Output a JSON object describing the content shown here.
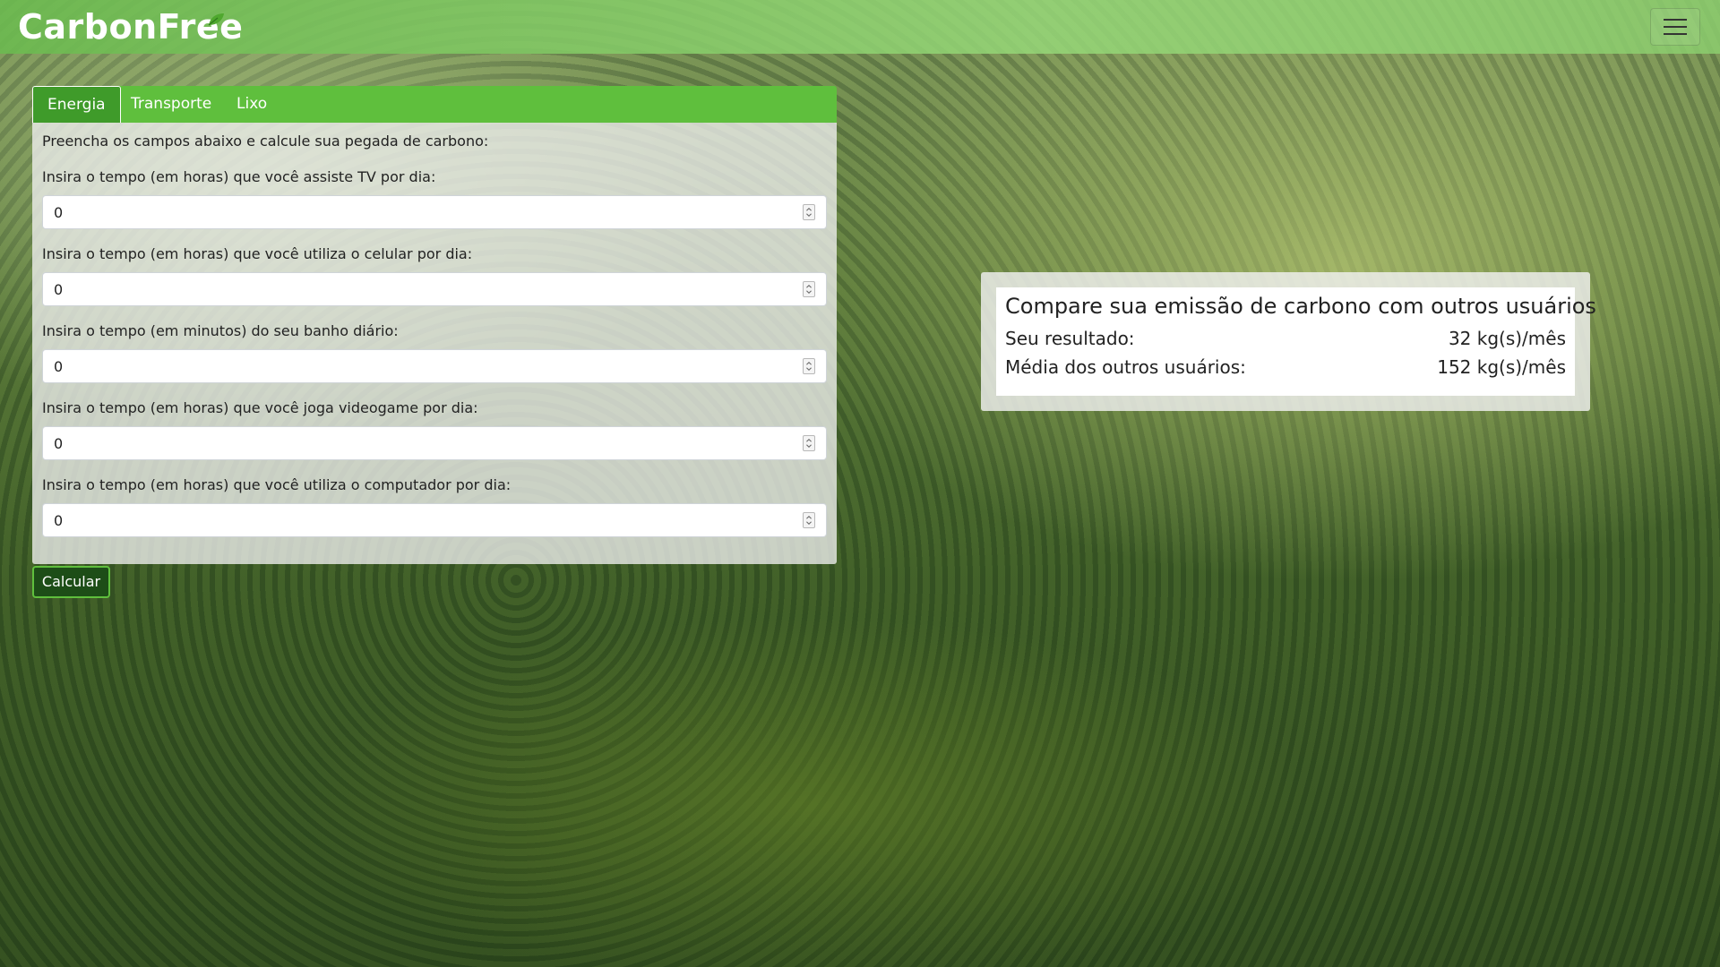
{
  "navbar": {
    "brand": "CarbonFree",
    "menu_icon": "hamburger-icon"
  },
  "tabs": [
    {
      "label": "Energia",
      "active": true
    },
    {
      "label": "Transporte",
      "active": false
    },
    {
      "label": "Lixo",
      "active": false
    }
  ],
  "form": {
    "intro": "Preencha os campos abaixo e calcule sua pegada de carbono:",
    "fields": [
      {
        "label": "Insira o tempo (em horas) que você assiste TV por dia:",
        "value": "0"
      },
      {
        "label": "Insira o tempo (em horas) que você utiliza o celular por dia:",
        "value": "0"
      },
      {
        "label": "Insira o tempo (em minutos) do seu banho diário:",
        "value": "0"
      },
      {
        "label": "Insira o tempo (em horas) que você joga videogame por dia:",
        "value": "0"
      },
      {
        "label": "Insira o tempo (em horas) que você utiliza o computador por dia:",
        "value": "0"
      }
    ],
    "submit_label": "Calcular"
  },
  "comparison": {
    "title": "Compare sua emissão de carbono com outros usuários",
    "your_result_label": "Seu resultado:",
    "your_result_value": "32 kg(s)/mês",
    "average_label": "Média dos outros usuários:",
    "average_value": "152 kg(s)/mês"
  },
  "colors": {
    "tab_bar": "#5fbf3d",
    "tab_active": "#3f9b2a",
    "button_bg": "#1d4d17"
  }
}
